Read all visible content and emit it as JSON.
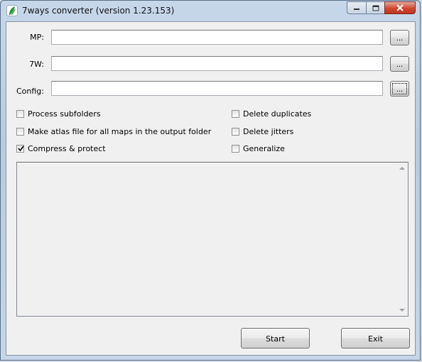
{
  "window": {
    "title": "7ways converter (version 1.23.153)",
    "icon": "leaf-app-icon",
    "caption_buttons": [
      "minimize-icon",
      "maximize-icon",
      "close-icon"
    ]
  },
  "fields": [
    {
      "label": "MP:",
      "value": "",
      "browse_label": "..."
    },
    {
      "label": "7W:",
      "value": "",
      "browse_label": "..."
    },
    {
      "label": "Config:",
      "value": "",
      "browse_label": "..."
    }
  ],
  "options_left": [
    {
      "label": "Process subfolders",
      "checked": false
    },
    {
      "label": "Make atlas file for all maps in the output folder",
      "checked": false
    },
    {
      "label": "Compress & protect",
      "checked": true
    }
  ],
  "options_right": [
    {
      "label": "Delete duplicates",
      "checked": false
    },
    {
      "label": "Delete jitters",
      "checked": false
    },
    {
      "label": "Generalize",
      "checked": false
    }
  ],
  "log": {
    "text": ""
  },
  "buttons": {
    "start": "Start",
    "exit": "Exit"
  }
}
